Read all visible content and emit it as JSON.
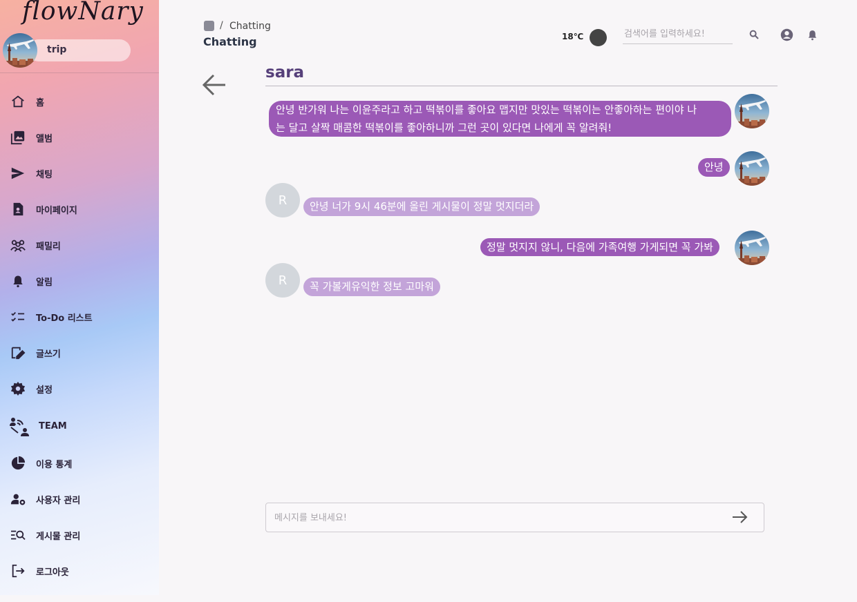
{
  "app": {
    "logo": "flowNary"
  },
  "user": {
    "name": "trip"
  },
  "sidebar": {
    "items": [
      {
        "label": "홈",
        "icon": "home-icon"
      },
      {
        "label": "앨범",
        "icon": "album-icon"
      },
      {
        "label": "채팅",
        "icon": "send-icon"
      },
      {
        "label": "마이페이지",
        "icon": "badge-icon"
      },
      {
        "label": "패밀리",
        "icon": "family-icon"
      },
      {
        "label": "알림",
        "icon": "bell-icon"
      },
      {
        "label": "To-Do 리스트",
        "icon": "checklist-icon"
      },
      {
        "label": "글쓰기",
        "icon": "write-icon"
      },
      {
        "label": "설정",
        "icon": "gear-icon"
      },
      {
        "label": "TEAM",
        "icon": "team-icon"
      },
      {
        "label": "이용 통계",
        "icon": "pie-chart-icon"
      },
      {
        "label": "사용자 관리",
        "icon": "user-manage-icon"
      },
      {
        "label": "게시물 관리",
        "icon": "post-manage-icon"
      },
      {
        "label": "로그아웃",
        "icon": "logout-icon"
      }
    ]
  },
  "header": {
    "breadcrumb": "Chatting",
    "title": "Chatting",
    "temperature": "18℃",
    "search_placeholder": "검색어를 입력하세요!"
  },
  "chat": {
    "partner": "sara",
    "partner_initial": "R",
    "messages": [
      {
        "from": "me",
        "lines": [
          "안녕 반가워 나는 이윤주라고 하고 떡볶이를 좋아요 맵지만 맛있는 떡볶이는 안좋아하는 편이야 나",
          "는 달고 살짝 매콤한 떡볶이를 좋아하니까 그런 곳이 있다면 나에게 꼭 알려줘!"
        ]
      },
      {
        "from": "me",
        "text": "안녕"
      },
      {
        "from": "them",
        "text": "안녕 너가 9시 46분에 올린 게시물이 정말 멋지더라"
      },
      {
        "from": "me",
        "text": "정말 멋지지 않니, 다음에 가족여행 가게되면 꼭 가봐"
      },
      {
        "from": "them",
        "text": "꼭 가볼게유익한 정보 고마워"
      }
    ],
    "input_placeholder": "메시지를 보내세요!"
  },
  "colors": {
    "my_bubble": "#9b59b6",
    "their_bubble": "#c3a4d9",
    "partner_name": "#56407a"
  }
}
